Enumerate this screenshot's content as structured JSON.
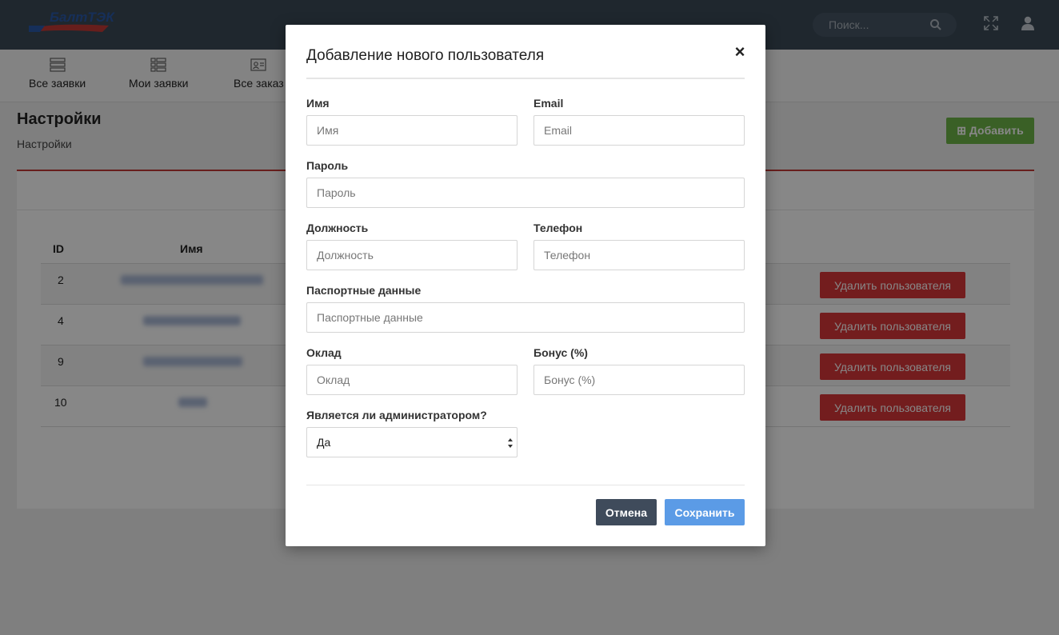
{
  "header": {
    "logo_text": "БалтТЭК",
    "search_placeholder": "Поиск..."
  },
  "nav": {
    "items": [
      {
        "label": "Все заявки"
      },
      {
        "label": "Мои заявки"
      },
      {
        "label": "Все заказ"
      }
    ]
  },
  "page": {
    "title": "Настройки",
    "breadcrumb": "Настройки",
    "add_button": "Добавить"
  },
  "table": {
    "headers": [
      "ID",
      "Имя"
    ],
    "rows": [
      {
        "id": "2",
        "action": "Удалить пользователя"
      },
      {
        "id": "4",
        "action": "Удалить пользователя"
      },
      {
        "id": "9",
        "action": "Удалить пользователя"
      },
      {
        "id": "10",
        "action": "Удалить пользователя"
      }
    ]
  },
  "modal": {
    "title": "Добавление нового пользователя",
    "close": "×",
    "fields": {
      "name": {
        "label": "Имя",
        "placeholder": "Имя"
      },
      "email": {
        "label": "Email",
        "placeholder": "Email"
      },
      "password": {
        "label": "Пароль",
        "placeholder": "Пароль"
      },
      "position": {
        "label": "Должность",
        "placeholder": "Должность"
      },
      "phone": {
        "label": "Телефон",
        "placeholder": "Телефон"
      },
      "passport": {
        "label": "Паспортные данные",
        "placeholder": "Паспортные данные"
      },
      "salary": {
        "label": "Оклад",
        "placeholder": "Оклад"
      },
      "bonus": {
        "label": "Бонус (%)",
        "placeholder": "Бонус (%)"
      },
      "is_admin": {
        "label": "Является ли администратором?",
        "value": "Да"
      }
    },
    "cancel_button": "Отмена",
    "save_button": "Сохранить"
  },
  "colors": {
    "topbar": "#3b4a58",
    "add_button": "#6fb548",
    "delete_button": "#d9383a",
    "save_button": "#5b9be6",
    "cancel_button": "#3f4b5b"
  }
}
